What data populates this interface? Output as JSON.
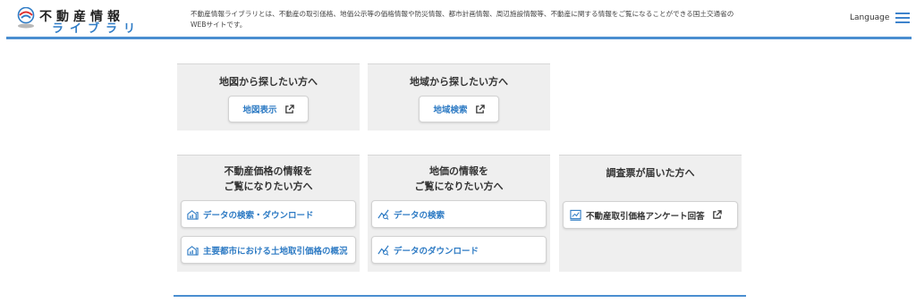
{
  "header": {
    "logo_title": "不動産情報",
    "logo_sub": "ライブラリ",
    "description": "不動産情報ライブラリとは、不動産の取引価格、地価公示等の価格情報や防災情報、都市計画情報、周辺施設情報等、不動産に関する情報をご覧になることができる国土交通省のWEBサイトです。",
    "language_label": "Language",
    "menu_icon": "hamburger-menu-icon"
  },
  "cards": {
    "map_search": {
      "title": "地図から探したい方へ",
      "button_label": "地図表示",
      "button_icon": "external-link-icon"
    },
    "area_search": {
      "title": "地域から探したい方へ",
      "button_label": "地域検索",
      "button_icon": "external-link-icon"
    },
    "real_estate_price": {
      "title_line1": "不動産価格の情報を",
      "title_line2": "ご覧になりたい方へ",
      "buttons": [
        {
          "label": "データの検索・ダウンロード",
          "icon": "house-chart-icon"
        },
        {
          "label": "主要都市における土地取引価格の概況",
          "icon": "house-chart-icon"
        }
      ]
    },
    "land_price": {
      "title_line1": "地価の情報を",
      "title_line2": "ご覧になりたい方へ",
      "buttons": [
        {
          "label": "データの検索",
          "icon": "price-trend-icon"
        },
        {
          "label": "データのダウンロード",
          "icon": "price-trend-icon"
        }
      ]
    },
    "survey": {
      "title": "調査票が届いた方へ",
      "button_label": "不動産取引価格アンケート回答",
      "button_icon": "external-link-icon",
      "lead_icon": "survey-chart-icon"
    }
  },
  "colors": {
    "accent": "#2e7bc4",
    "header_line": "#4a8ed0",
    "card_bg": "#efefef"
  }
}
